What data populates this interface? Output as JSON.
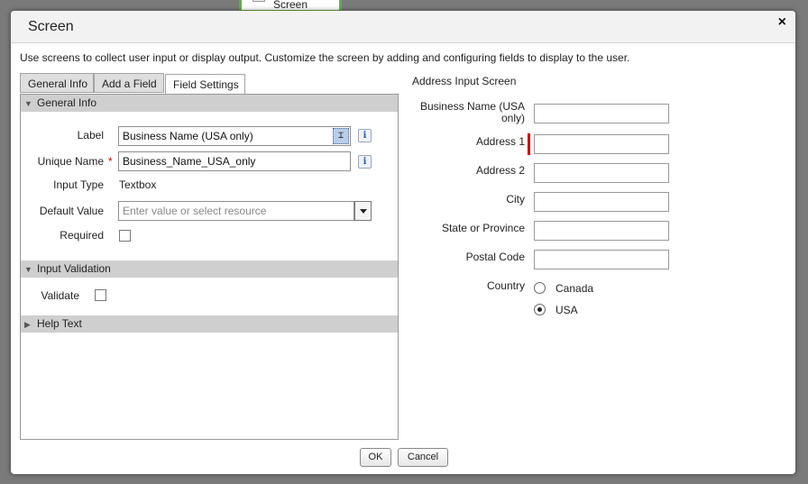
{
  "background": {
    "node_label": "Screen"
  },
  "dialog": {
    "title": "Screen",
    "close_label": "×",
    "instructions": "Use screens to collect user input or display output. Customize the screen by adding and configuring fields to display to the user."
  },
  "tabs": [
    {
      "label": "General Info",
      "active": false
    },
    {
      "label": "Add a Field",
      "active": false
    },
    {
      "label": "Field Settings",
      "active": true
    }
  ],
  "field_settings": {
    "general_info_header": "General Info",
    "label_label": "Label",
    "label_value": "Business Name (USA only)",
    "unique_name_label": "Unique Name",
    "unique_name_value": "Business_Name_USA_only",
    "required_marker": "*",
    "input_type_label": "Input Type",
    "input_type_value": "Textbox",
    "default_value_label": "Default Value",
    "default_value_placeholder": "Enter value or select resource",
    "required_label": "Required",
    "required_checked": false,
    "input_validation_header": "Input Validation",
    "validate_label": "Validate",
    "validate_checked": false,
    "help_text_header": "Help Text",
    "info_icon_text": "i",
    "selector_glyph": "⌶"
  },
  "preview": {
    "title": "Address Input Screen",
    "fields": [
      {
        "label": "Business Name (USA only)",
        "value": ""
      },
      {
        "label": "Address 1",
        "value": "",
        "required": true
      },
      {
        "label": "Address 2",
        "value": ""
      },
      {
        "label": "City",
        "value": ""
      },
      {
        "label": "State or Province",
        "value": ""
      },
      {
        "label": "Postal Code",
        "value": ""
      }
    ],
    "country_label": "Country",
    "country_options": [
      {
        "label": "Canada",
        "selected": false
      },
      {
        "label": "USA",
        "selected": true
      }
    ]
  },
  "footer": {
    "ok_label": "OK",
    "cancel_label": "Cancel"
  },
  "colors": {
    "accent_required": "#cc0000",
    "node_border": "#6aa84f",
    "section_bar": "#cfcfcf"
  }
}
